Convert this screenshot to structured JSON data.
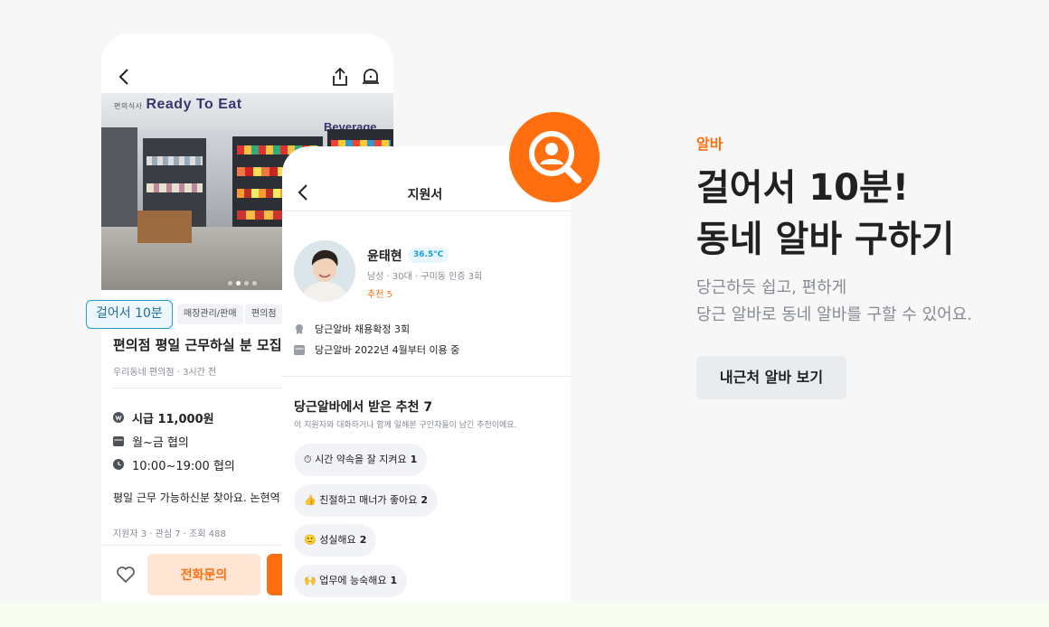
{
  "job_post": {
    "photo_sign_left": "Ready To Eat",
    "photo_sign_left_small": "편의식사",
    "photo_sign_right": "Beverage",
    "walk_tag": "걸어서 10분",
    "chips": [
      "매장관리/판매",
      "편의점"
    ],
    "title": "편의점 평일 근무하실 분 모집",
    "meta": "우리동네 편의점 · 3시간 전",
    "wage": "시급 11,000원",
    "days": "월~금 협의",
    "hours": "10:00~19:00 협의",
    "description": "평일 근무 가능하신분 찾아요. 논현역",
    "stats": "지원자 3 · 관심 7 · 조회 488",
    "call_label": "전화문의"
  },
  "application": {
    "title": "지원서",
    "name": "윤태현",
    "temperature": "36.5°C",
    "profile_sub": "남성 · 30대 · 구미동 인증 3회",
    "recommend": "추천 5",
    "history": [
      "당근알바 채용확정 3회",
      "당근알바 2022년 4월부터 이용 중"
    ],
    "rec_title": "당근알바에서 받은 추천 7",
    "rec_desc": "이 지원자와 대화하거나 함께 일해본 구인자들이 남긴 추천이에요.",
    "rec_items": [
      {
        "label": "⏱ 시간 약속을 잘 지켜요",
        "count": "1"
      },
      {
        "label": "👍 친절하고 매너가 좋아요",
        "count": "2"
      },
      {
        "label": "🙂 성실해요",
        "count": "2"
      },
      {
        "label": "🙌 업무에 능숙해요",
        "count": "1"
      }
    ]
  },
  "promo": {
    "eyebrow": "알바",
    "headline_line1": "걸어서 10분!",
    "headline_line2": "동네 알바 구하기",
    "sub_line1": "당근하듯 쉽고, 편하게",
    "sub_line2": "당근 알바로 동네 알바를 구할 수 있어요.",
    "cta": "내근처 알바 보기"
  },
  "colors": {
    "brand_orange": "#ff6f0f",
    "walk_tag_blue": "#2b9bd8",
    "bottom_band": "#f7fdf0"
  },
  "icons": {
    "back": "chevron-left-icon",
    "share": "share-icon",
    "bell": "bell-icon",
    "search": "search-person-icon",
    "heart": "heart-icon"
  }
}
